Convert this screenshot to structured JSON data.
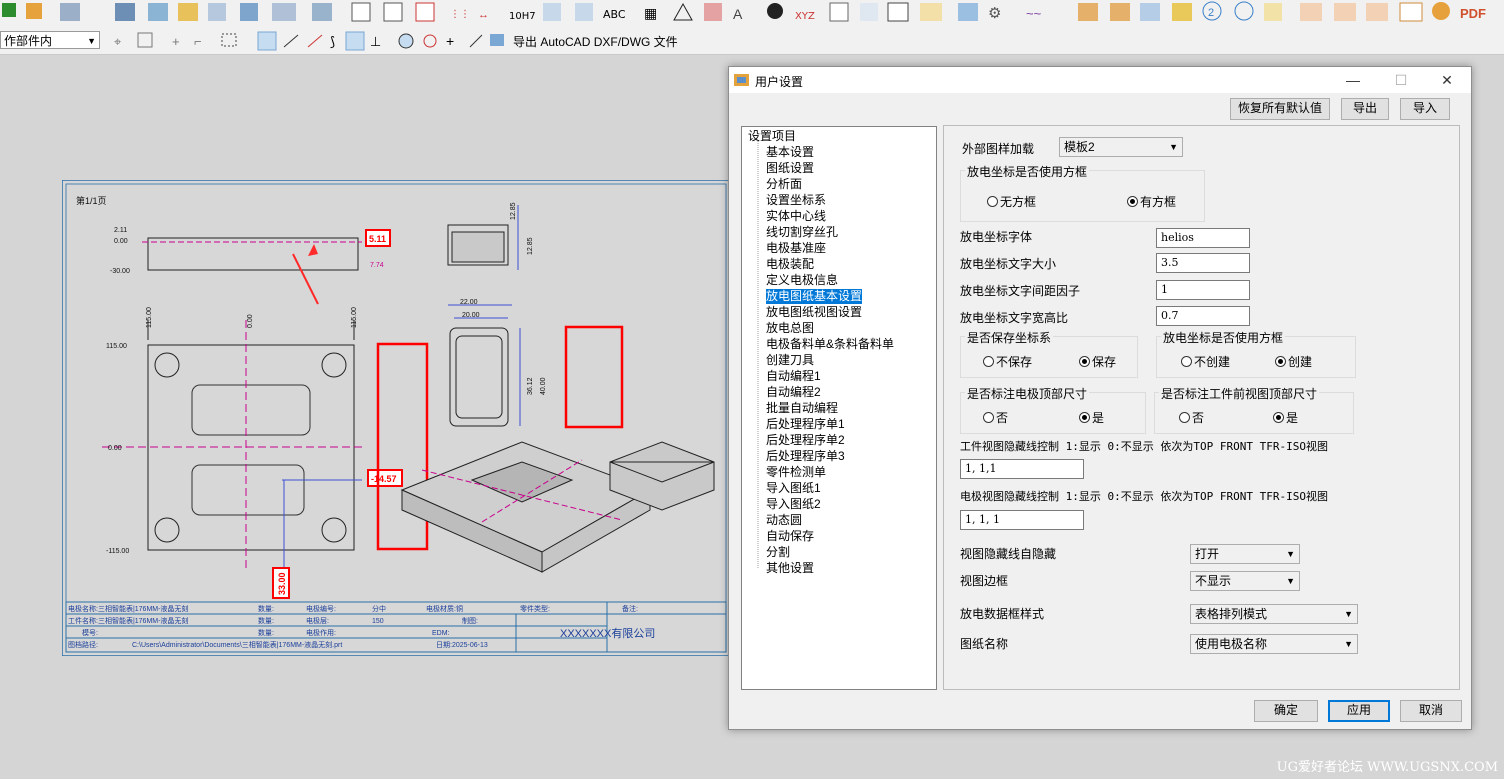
{
  "toolbar": {
    "filter_combo_value": "作部件内",
    "export_label": "导出 AutoCAD DXF/DWG 文件",
    "pdf_label": "PDF"
  },
  "drawing": {
    "sheet_label": "第1/1页",
    "dims": {
      "d1": "2.11",
      "d2": "0.00",
      "d3": "-30.00",
      "d4": "115.00",
      "d5": "0.00",
      "d6": "-115.00",
      "v1": "115.00",
      "v2": "0.00",
      "v3": "115.00",
      "w1": "22.00",
      "w2": "20.00",
      "h1": "12.85",
      "h2": "36.12",
      "h3": "40.00",
      "h4": "12.85"
    },
    "callout_top": "5.11",
    "callout_top_small": "7.74",
    "callout_mid": "-14.57",
    "callout_bottom": "33.00",
    "titleblock": {
      "r1c1": "电极名称:三相智能表|176MM-液晶无刻",
      "r1c2": "数量:",
      "r1c3": "电极编号:",
      "r1c4": "分中",
      "r1c5": "电极材质:铜",
      "r1c6": "零件类型:",
      "r1c7": "备注:",
      "r2c1": "工件名称:三相智能表|176MM-液晶无刻",
      "r2c2": "数量:",
      "r2c3": "电极层:",
      "r2c4": "150",
      "r2c5": "制图:",
      "r3c1": "模号:",
      "r3c2": "数量:",
      "r3c3": "电极作用:",
      "r3c4": "EDM:",
      "r4c1": "图档路径:",
      "r4c2": "C:\\Users\\Administrator\\Documents\\三相智能表|176MM-液晶无刻.prt",
      "r4c3": "日期:2025-06-13",
      "company": "XXXXXXX有限公司"
    }
  },
  "dialog": {
    "title": "用户设置",
    "buttons": {
      "restore": "恢复所有默认值",
      "export": "导出",
      "import": "导入",
      "ok": "确定",
      "apply": "应用",
      "cancel": "取消"
    },
    "tree": {
      "root": "设置项目",
      "items": [
        "基本设置",
        "图纸设置",
        "分析面",
        "设置坐标系",
        "实体中心线",
        "线切割穿丝孔",
        "电极基准座",
        "电极装配",
        "定义电极信息",
        "放电图纸基本设置",
        "放电图纸视图设置",
        "放电总图",
        "电极备料单&条料备料单",
        "创建刀具",
        "自动编程1",
        "自动编程2",
        "批量自动编程",
        "后处理程序单1",
        "后处理程序单2",
        "后处理程序单3",
        "零件检测单",
        "导入图纸1",
        "导入图纸2",
        "动态圆",
        "自动保存",
        "分割",
        "其他设置"
      ],
      "selected_index": 9
    },
    "panel": {
      "ext_template_label": "外部图样加载",
      "ext_template_value": "模板2",
      "frame_group": "放电坐标是否使用方框",
      "frame_no": "无方框",
      "frame_yes": "有方框",
      "font_label": "放电坐标字体",
      "font_value": "helios",
      "size_label": "放电坐标文字大小",
      "size_value": "3.5",
      "spacing_label": "放电坐标文字间距因子",
      "spacing_value": "1",
      "ratio_label": "放电坐标文字宽高比",
      "ratio_value": "0.7",
      "save_group": "是否保存坐标系",
      "save_no": "不保存",
      "save_yes": "保存",
      "use_frame_group": "放电坐标是否使用方框",
      "create_no": "不创建",
      "create_yes": "创建",
      "top_dim_group": "是否标注电极顶部尺寸",
      "top_no": "否",
      "top_yes": "是",
      "front_dim_group": "是否标注工件前视图顶部尺寸",
      "front_no": "否",
      "front_yes": "是",
      "part_hidden_label": "工件视图隐藏线控制 1:显示 0:不显示 依次为TOP FRONT TFR-ISO视图",
      "part_hidden_value": "1, 1,1",
      "elec_hidden_label": "电极视图隐藏线控制 1:显示 0:不显示 依次为TOP FRONT TFR-ISO视图",
      "elec_hidden_value": "1, 1, 1",
      "auto_hide_label": "视图隐藏线自隐藏",
      "auto_hide_value": "打开",
      "border_label": "视图边框",
      "border_value": "不显示",
      "datastyle_label": "放电数据框样式",
      "datastyle_value": "表格排列模式",
      "drawname_label": "图纸名称",
      "drawname_value": "使用电极名称"
    }
  },
  "watermark": "UG爱好者论坛 WWW.UGSNX.COM",
  "colors": {
    "accent": "#0078d7",
    "callout_red": "#ff0000",
    "sheet_line": "#1a1a1a",
    "dim_magenta": "#c8008c"
  }
}
